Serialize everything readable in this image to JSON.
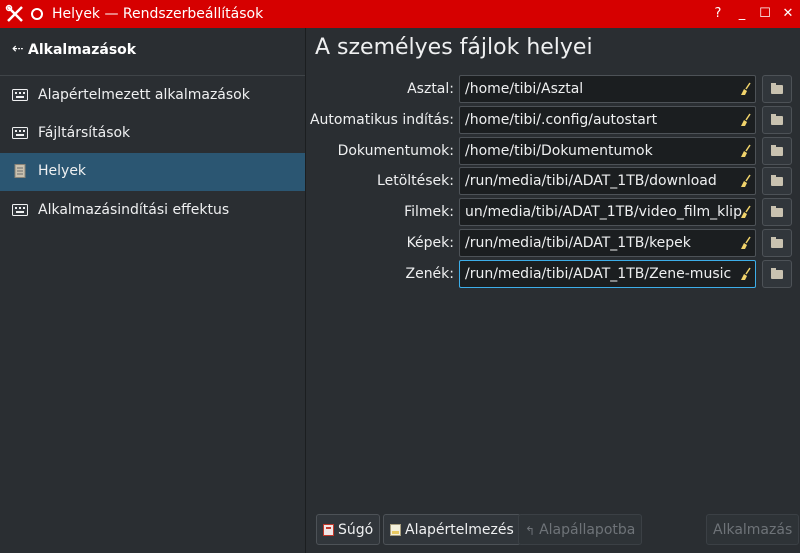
{
  "window": {
    "title": "Helyek — Rendszerbeállítások",
    "buttons": {
      "help": "?",
      "minimize": "_",
      "maximize": "☐",
      "close": "✕"
    },
    "accent": "#d60000"
  },
  "sidebar": {
    "back_label": "Alkalmazások",
    "items": [
      {
        "label": "Alapértelmezett alkalmazások",
        "icon": "keyboard-icon",
        "active": false
      },
      {
        "label": "Fájltársítások",
        "icon": "keyboard-icon",
        "active": false
      },
      {
        "label": "Helyek",
        "icon": "document-icon",
        "active": true
      },
      {
        "label": "Alkalmazásindítási effektus",
        "icon": "keyboard-icon",
        "active": false
      }
    ],
    "active_color": "#2b5672"
  },
  "main": {
    "title": "A személyes fájlok helyei",
    "rows": [
      {
        "label": "Asztal:",
        "value": "/home/tibi/Asztal"
      },
      {
        "label": "Automatikus indítás:",
        "value": "/home/tibi/.config/autostart"
      },
      {
        "label": "Dokumentumok:",
        "value": "/home/tibi/Dokumentumok"
      },
      {
        "label": "Letöltések:",
        "value": "/run/media/tibi/ADAT_1TB/download"
      },
      {
        "label": "Filmek:",
        "value": "un/media/tibi/ADAT_1TB/video_film_klip"
      },
      {
        "label": "Képek:",
        "value": "/run/media/tibi/ADAT_1TB/kepek"
      },
      {
        "label": "Zenék:",
        "value": "/run/media/tibi/ADAT_1TB/Zene-music"
      }
    ]
  },
  "footer": {
    "help": "Súgó",
    "defaults": "Alapértelmezés",
    "reset": "Alapállapotba",
    "apply": "Alkalmazás"
  }
}
